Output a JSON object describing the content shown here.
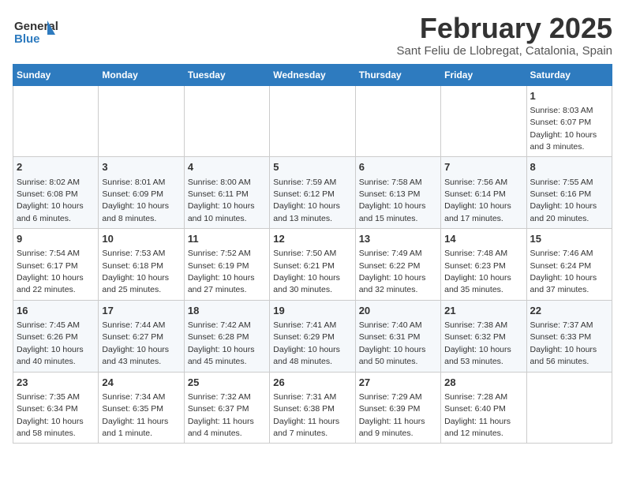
{
  "header": {
    "logo_general": "General",
    "logo_blue": "Blue",
    "month": "February 2025",
    "location": "Sant Feliu de Llobregat, Catalonia, Spain"
  },
  "days_of_week": [
    "Sunday",
    "Monday",
    "Tuesday",
    "Wednesday",
    "Thursday",
    "Friday",
    "Saturday"
  ],
  "weeks": [
    [
      {
        "day": "",
        "info": ""
      },
      {
        "day": "",
        "info": ""
      },
      {
        "day": "",
        "info": ""
      },
      {
        "day": "",
        "info": ""
      },
      {
        "day": "",
        "info": ""
      },
      {
        "day": "",
        "info": ""
      },
      {
        "day": "1",
        "info": "Sunrise: 8:03 AM\nSunset: 6:07 PM\nDaylight: 10 hours and 3 minutes."
      }
    ],
    [
      {
        "day": "2",
        "info": "Sunrise: 8:02 AM\nSunset: 6:08 PM\nDaylight: 10 hours and 6 minutes."
      },
      {
        "day": "3",
        "info": "Sunrise: 8:01 AM\nSunset: 6:09 PM\nDaylight: 10 hours and 8 minutes."
      },
      {
        "day": "4",
        "info": "Sunrise: 8:00 AM\nSunset: 6:11 PM\nDaylight: 10 hours and 10 minutes."
      },
      {
        "day": "5",
        "info": "Sunrise: 7:59 AM\nSunset: 6:12 PM\nDaylight: 10 hours and 13 minutes."
      },
      {
        "day": "6",
        "info": "Sunrise: 7:58 AM\nSunset: 6:13 PM\nDaylight: 10 hours and 15 minutes."
      },
      {
        "day": "7",
        "info": "Sunrise: 7:56 AM\nSunset: 6:14 PM\nDaylight: 10 hours and 17 minutes."
      },
      {
        "day": "8",
        "info": "Sunrise: 7:55 AM\nSunset: 6:16 PM\nDaylight: 10 hours and 20 minutes."
      }
    ],
    [
      {
        "day": "9",
        "info": "Sunrise: 7:54 AM\nSunset: 6:17 PM\nDaylight: 10 hours and 22 minutes."
      },
      {
        "day": "10",
        "info": "Sunrise: 7:53 AM\nSunset: 6:18 PM\nDaylight: 10 hours and 25 minutes."
      },
      {
        "day": "11",
        "info": "Sunrise: 7:52 AM\nSunset: 6:19 PM\nDaylight: 10 hours and 27 minutes."
      },
      {
        "day": "12",
        "info": "Sunrise: 7:50 AM\nSunset: 6:21 PM\nDaylight: 10 hours and 30 minutes."
      },
      {
        "day": "13",
        "info": "Sunrise: 7:49 AM\nSunset: 6:22 PM\nDaylight: 10 hours and 32 minutes."
      },
      {
        "day": "14",
        "info": "Sunrise: 7:48 AM\nSunset: 6:23 PM\nDaylight: 10 hours and 35 minutes."
      },
      {
        "day": "15",
        "info": "Sunrise: 7:46 AM\nSunset: 6:24 PM\nDaylight: 10 hours and 37 minutes."
      }
    ],
    [
      {
        "day": "16",
        "info": "Sunrise: 7:45 AM\nSunset: 6:26 PM\nDaylight: 10 hours and 40 minutes."
      },
      {
        "day": "17",
        "info": "Sunrise: 7:44 AM\nSunset: 6:27 PM\nDaylight: 10 hours and 43 minutes."
      },
      {
        "day": "18",
        "info": "Sunrise: 7:42 AM\nSunset: 6:28 PM\nDaylight: 10 hours and 45 minutes."
      },
      {
        "day": "19",
        "info": "Sunrise: 7:41 AM\nSunset: 6:29 PM\nDaylight: 10 hours and 48 minutes."
      },
      {
        "day": "20",
        "info": "Sunrise: 7:40 AM\nSunset: 6:31 PM\nDaylight: 10 hours and 50 minutes."
      },
      {
        "day": "21",
        "info": "Sunrise: 7:38 AM\nSunset: 6:32 PM\nDaylight: 10 hours and 53 minutes."
      },
      {
        "day": "22",
        "info": "Sunrise: 7:37 AM\nSunset: 6:33 PM\nDaylight: 10 hours and 56 minutes."
      }
    ],
    [
      {
        "day": "23",
        "info": "Sunrise: 7:35 AM\nSunset: 6:34 PM\nDaylight: 10 hours and 58 minutes."
      },
      {
        "day": "24",
        "info": "Sunrise: 7:34 AM\nSunset: 6:35 PM\nDaylight: 11 hours and 1 minute."
      },
      {
        "day": "25",
        "info": "Sunrise: 7:32 AM\nSunset: 6:37 PM\nDaylight: 11 hours and 4 minutes."
      },
      {
        "day": "26",
        "info": "Sunrise: 7:31 AM\nSunset: 6:38 PM\nDaylight: 11 hours and 7 minutes."
      },
      {
        "day": "27",
        "info": "Sunrise: 7:29 AM\nSunset: 6:39 PM\nDaylight: 11 hours and 9 minutes."
      },
      {
        "day": "28",
        "info": "Sunrise: 7:28 AM\nSunset: 6:40 PM\nDaylight: 11 hours and 12 minutes."
      },
      {
        "day": "",
        "info": ""
      }
    ]
  ]
}
